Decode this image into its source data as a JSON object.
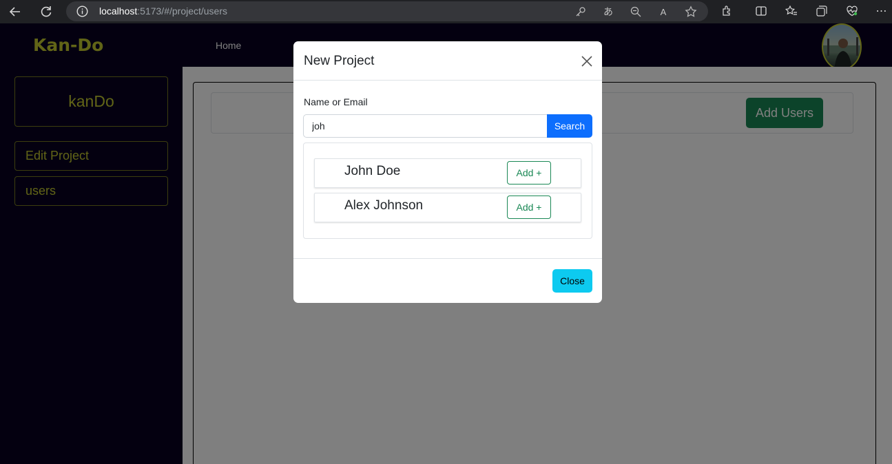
{
  "browser": {
    "url_host": "localhost",
    "url_path": ":5173/#/project/users"
  },
  "app": {
    "brand": "Kan-Do",
    "nav": {
      "home_label": "Home"
    }
  },
  "sidebar": {
    "project_title": "kanDo",
    "items": [
      {
        "label": "Edit Project"
      },
      {
        "label": "users"
      }
    ]
  },
  "main": {
    "add_users_label": "Add Users"
  },
  "modal": {
    "title": "New Project",
    "field_label": "Name or Email",
    "search_value": "joh",
    "search_button": "Search",
    "results": [
      {
        "name": "John Doe",
        "add_label": "Add +"
      },
      {
        "name": "Alex Johnson",
        "add_label": "Add +"
      }
    ],
    "close_label": "Close"
  },
  "colors": {
    "nav_bg": "#080021",
    "brand_accent": "#c3c92f",
    "success": "#198754",
    "primary": "#0d6efd",
    "info": "#0dcaf0"
  }
}
